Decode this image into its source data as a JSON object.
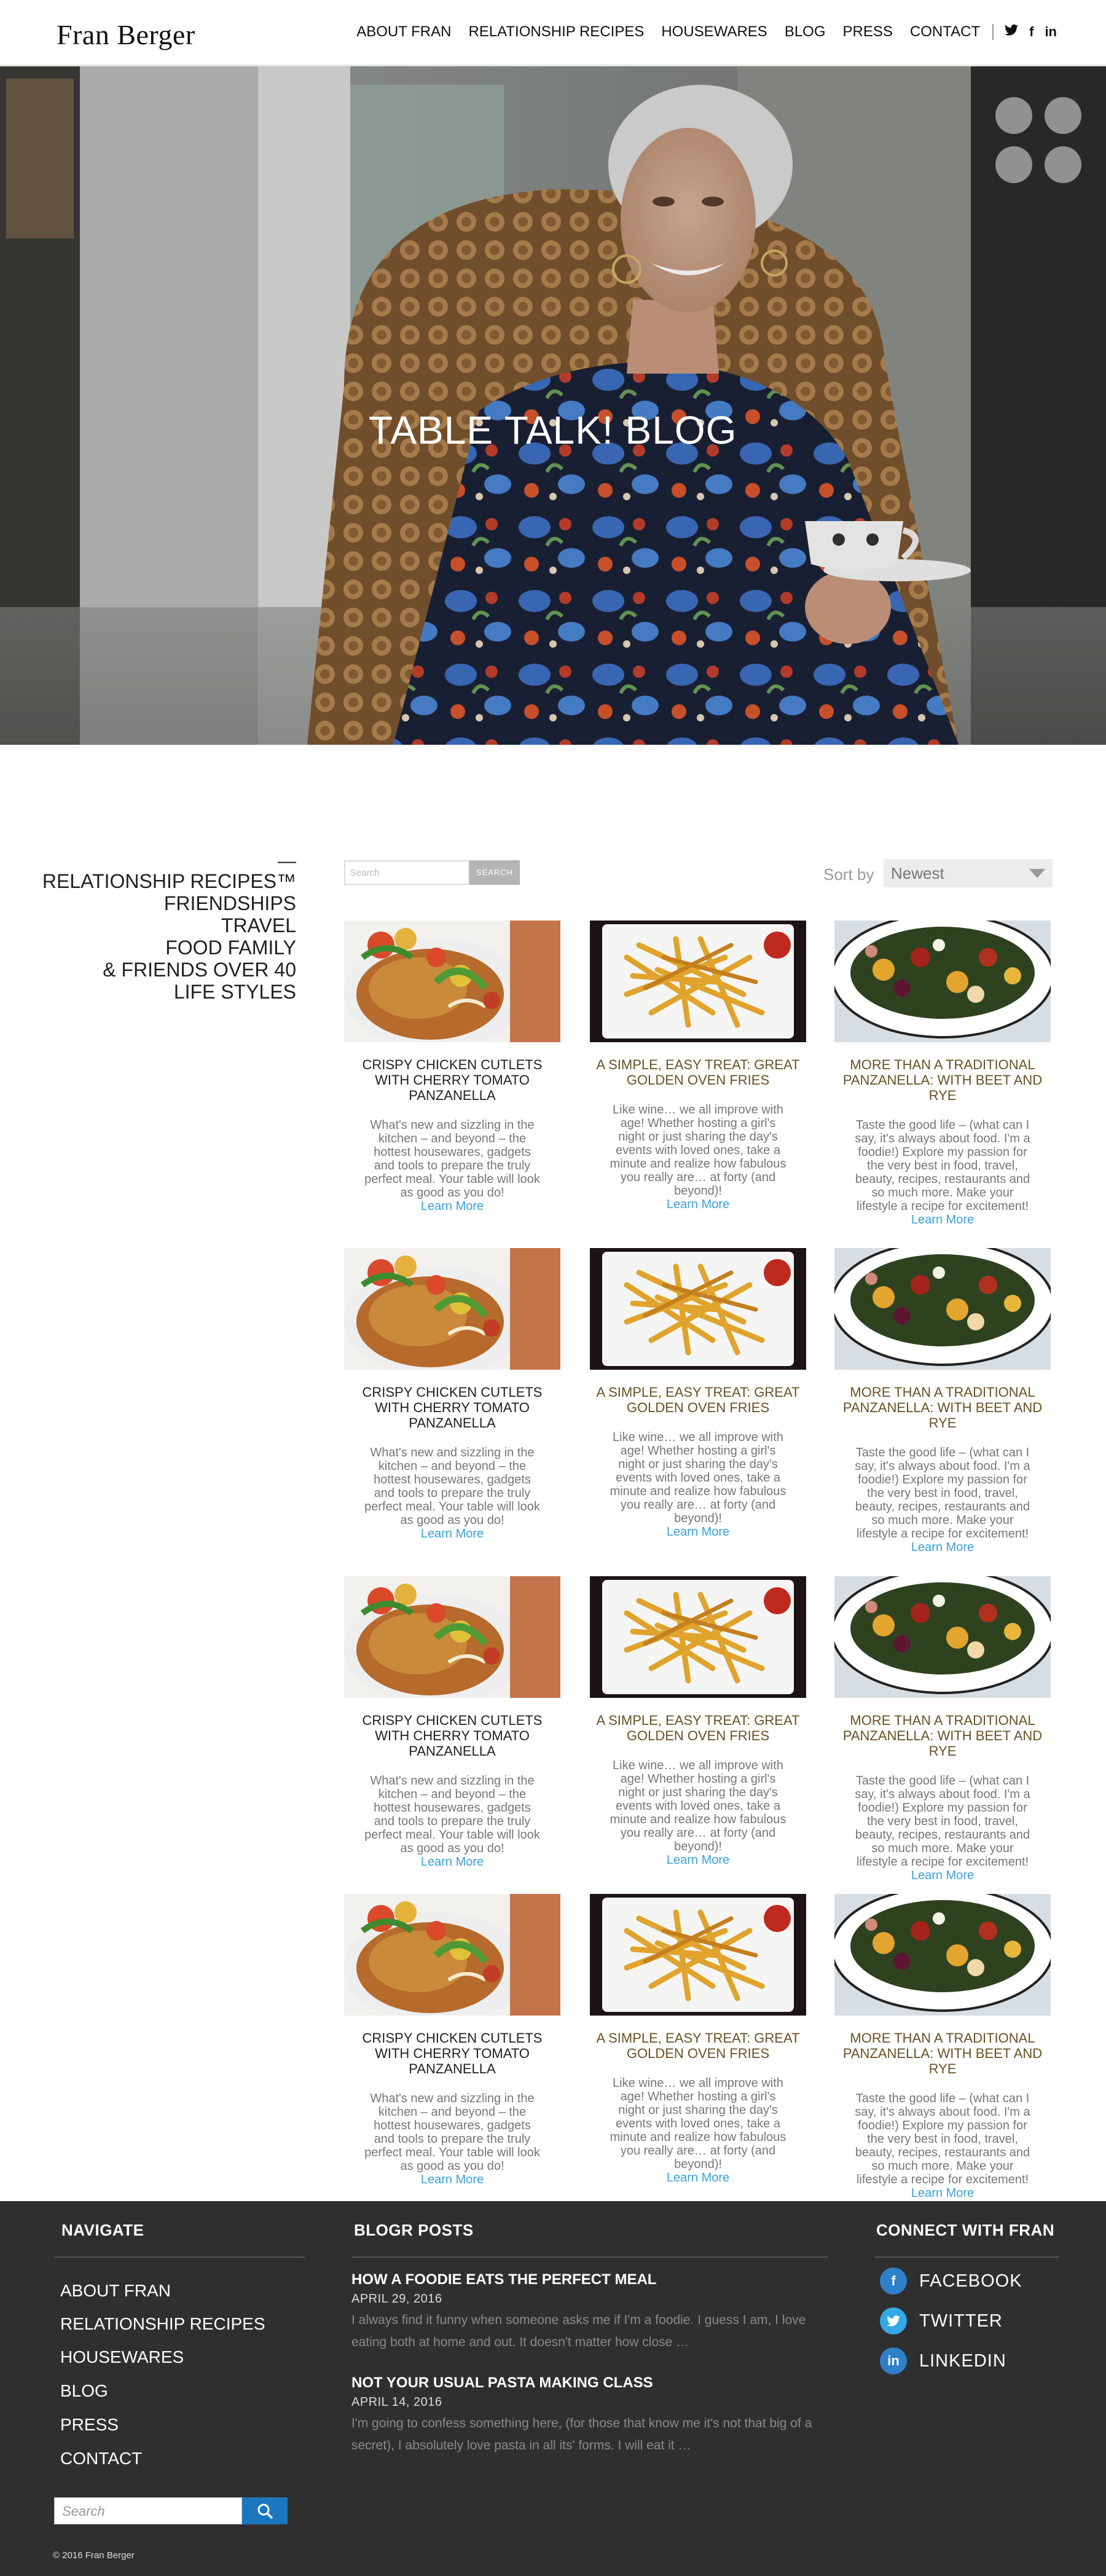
{
  "header": {
    "logo": "Fran Berger",
    "nav": [
      "ABOUT FRAN",
      "RELATIONSHIP RECIPES",
      "HOUSEWARES",
      "BLOG",
      "PRESS",
      "CONTACT"
    ],
    "social": [
      "twitter-icon",
      "facebook-icon",
      "linkedin-icon"
    ],
    "social_glyphs": {
      "twitter": "🐦",
      "facebook": "f",
      "linkedin": "in"
    }
  },
  "hero": {
    "title": "TABLE TALK! BLOG"
  },
  "categories": {
    "dash": "—",
    "items": [
      "RELATIONSHIP RECIPES™",
      "FRIENDSHIPS",
      "TRAVEL",
      "FOOD FAMILY",
      "& FRIENDS OVER 40",
      "LIFE STYLES"
    ]
  },
  "toolbar": {
    "search_placeholder": "Search",
    "search_button": "SEARCH",
    "sort_label": "Sort by",
    "sort_value": "Newest"
  },
  "posts": {
    "chicken": {
      "title": "CRISPY CHICKEN CUTLETS WITH CHERRY TOMATO PANZANELLA",
      "excerpt": "What's new and sizzling in the kitchen – and beyond – the hottest housewares, gadgets and tools to prepare the truly perfect meal.  Your table will look as good as you do!",
      "link": "Learn More"
    },
    "fries": {
      "title": "A SIMPLE, EASY TREAT: GREAT GOLDEN OVEN FRIES",
      "excerpt": "Like wine… we all improve with age! Whether hosting a girl's night or just sharing the day's events with loved ones, take a minute and realize how fabulous you really are… at forty (and beyond)!",
      "link": "Learn More"
    },
    "salad": {
      "title": "MORE THAN A TRADITIONAL PANZANELLA: WITH BEET AND RYE",
      "excerpt": "Taste the good life – (what can I say, it's always about food. I'm a foodie!) Explore my passion for the very best in food, travel, beauty, recipes, restaurants and so much more. Make your lifestyle a recipe for excitement!",
      "link": "Learn More"
    }
  },
  "footer": {
    "navigate_heading": "NAVIGATE",
    "navigate_items": [
      "ABOUT FRAN",
      "RELATIONSHIP RECIPES",
      "HOUSEWARES",
      "BLOG",
      "PRESS",
      "CONTACT"
    ],
    "blog_heading": "BLOGR POSTS",
    "blog_posts": [
      {
        "title": "HOW A FOODIE EATS THE PERFECT MEAL",
        "date": "APRIL 29, 2016",
        "excerpt": "I always find it funny when someone asks me if I'm a foodie.  I guess I am, I love eating both at home and out.  It doesn't matter how close …"
      },
      {
        "title": "NOT YOUR USUAL PASTA MAKING CLASS",
        "date": "APRIL 14, 2016",
        "excerpt": "I'm going to confess something here, (for those that know me it's not that big of a secret), I absolutely love pasta in all its' forms.  I will eat it …"
      }
    ],
    "connect_heading": "CONNECT WITH FRAN",
    "social": [
      {
        "label": "FACEBOOK",
        "icon": "facebook-icon",
        "glyph": "f"
      },
      {
        "label": "TWITTER",
        "icon": "twitter-icon",
        "glyph": "🐦"
      },
      {
        "label": "LINKEDIN",
        "icon": "linkedin-icon",
        "glyph": "in"
      }
    ],
    "search_placeholder": "Search",
    "copyright": "© 2016 Fran Berger"
  },
  "colors": {
    "link": "#3aa0d8",
    "footer_bg": "#2f2f2f",
    "title_brown": "#6a5124",
    "facebook": "#2f80c8",
    "twitter": "#35a8e6",
    "search_button": "#1a77c0"
  }
}
